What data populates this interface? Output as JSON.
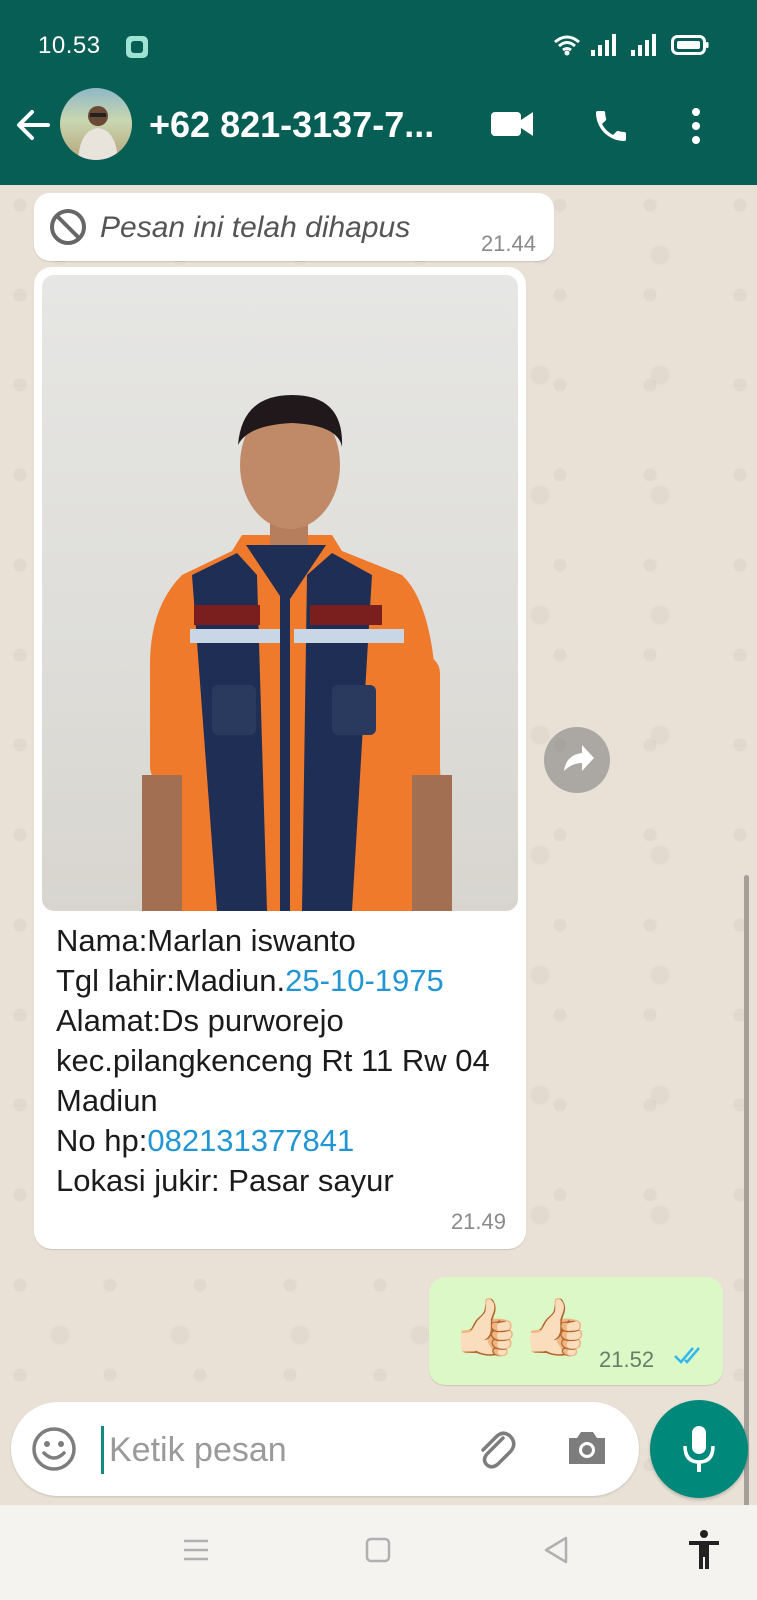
{
  "status_bar": {
    "time": "10.53",
    "icons": [
      "app-notification-icon",
      "wifi-icon",
      "signal-icon",
      "signal-icon",
      "battery-icon"
    ]
  },
  "header": {
    "contact": "+62 821-3137-7...",
    "icons": [
      "back-arrow-icon",
      "video-call-icon",
      "phone-icon",
      "more-vert-icon"
    ]
  },
  "messages": [
    {
      "type": "deleted",
      "direction": "incoming",
      "text": "Pesan ini telah dihapus",
      "time": "21.44"
    },
    {
      "type": "image",
      "direction": "incoming",
      "time": "21.49",
      "caption": {
        "line1": "Nama:Marlan iswanto",
        "line2_prefix": "Tgl lahir:Madiun.",
        "line2_link": "25-10-1975",
        "line3": "Alamat:Ds purworejo kec.pilangkenceng Rt 11 Rw 04 Madiun",
        "line4_prefix": "No hp:",
        "line4_link": "082131377841",
        "line5": "Lokasi jukir: Pasar sayur"
      }
    },
    {
      "type": "emoji",
      "direction": "outgoing",
      "text": "👍🏻👍🏻",
      "time": "21.52",
      "status": "read"
    }
  ],
  "composer": {
    "placeholder": "Ketik pesan",
    "value": ""
  },
  "colors": {
    "header": "#075e54",
    "accent": "#00897b",
    "outgoing_bubble": "#dcf8c6",
    "link": "#2196d3",
    "read_ticks": "#34b7f1"
  }
}
